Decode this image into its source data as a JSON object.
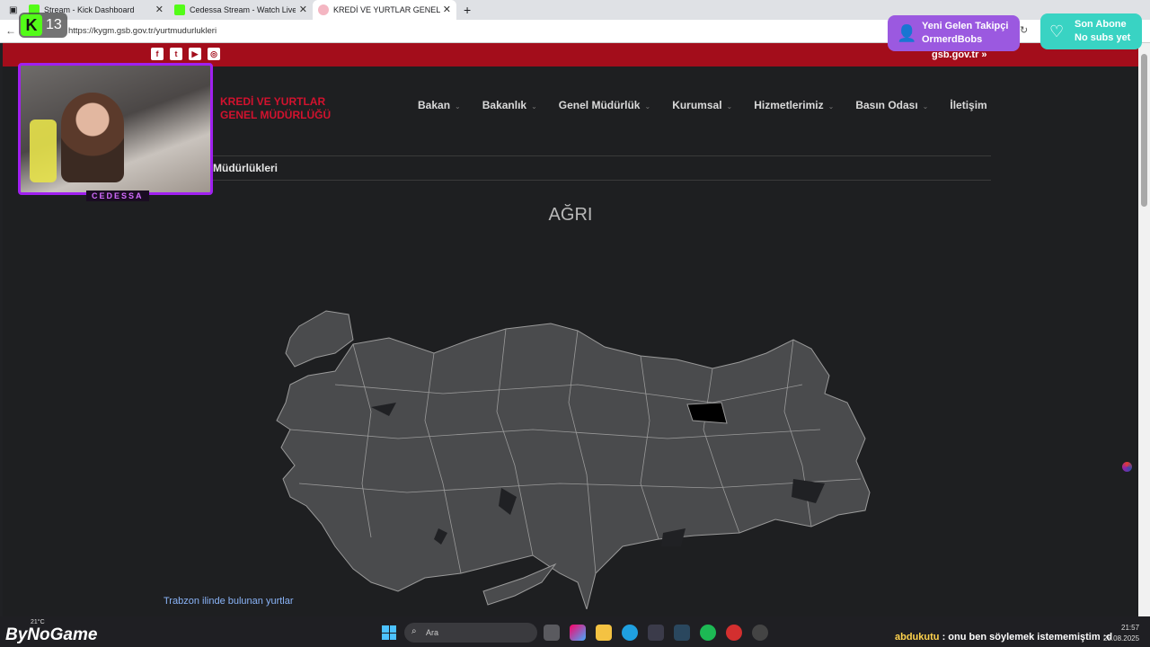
{
  "browser": {
    "tabs": [
      {
        "title": "Stream - Kick Dashboard",
        "favicon_color": "#53fc18"
      },
      {
        "title": "Cedessa Stream - Watch Live on K",
        "favicon_color": "#53fc18"
      },
      {
        "title": "KREDİ VE YURTLAR GENEL MÜDÜ",
        "favicon_color": "#f4b6c2"
      }
    ],
    "url": "https://kygm.gsb.gov.tr/yurtmudurlukleri",
    "new_tab_symbol": "+"
  },
  "site": {
    "gov_link": "gsb.gov.tr »",
    "logo_line1": "KREDİ VE YURTLAR",
    "logo_line2": "GENEL MÜDÜRLÜĞÜ",
    "nav": [
      "Bakan",
      "Bakanlık",
      "Genel Müdürlük",
      "Kurumsal",
      "Hizmetlerimiz",
      "Basın Odası",
      "İletişim"
    ],
    "breadcrumb": "Müdürlükleri",
    "map_title": "AĞRI",
    "footer_link": "Trabzon ilinde bulunan yurtlar"
  },
  "overlay": {
    "kick_count": "13",
    "cam_label": "CEDESSA",
    "follower_alert": {
      "line1": "Yeni Gelen Takipçi",
      "line2": "OrmerdBobs"
    },
    "sub_alert": {
      "line1": "Son Abone",
      "line2": "No subs yet"
    }
  },
  "taskbar": {
    "brand": "ByNoGame",
    "weather": "21°C",
    "search_placeholder": "Ara",
    "chat_user": "abdukutu",
    "chat_message": ": onu ben söylemek istememiştim :d",
    "time": "21:57",
    "date": "25.08.2025"
  },
  "colors": {
    "gov_red": "#a30d1b",
    "logo_red": "#d2122e",
    "map_fill": "#4a4b4d",
    "map_border": "#9a9a9a",
    "highlight_province": "#000000"
  }
}
